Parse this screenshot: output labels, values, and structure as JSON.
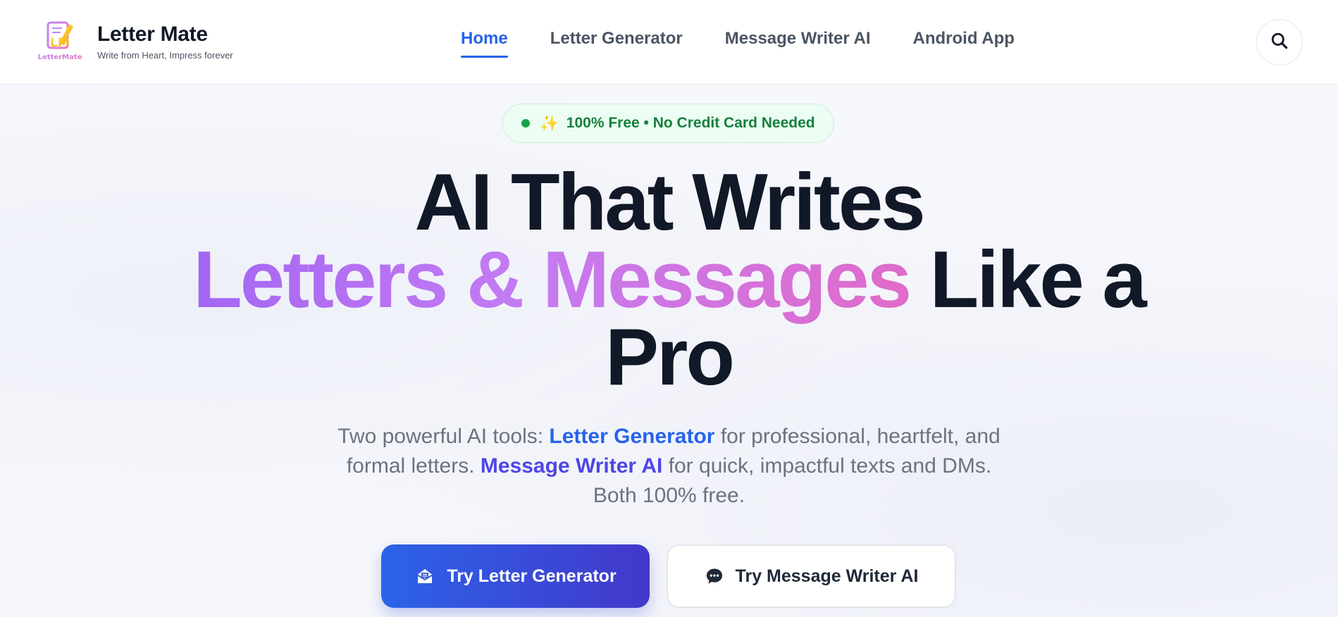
{
  "brand": {
    "name": "Letter Mate",
    "tagline": "Write from Heart, Impress forever",
    "logo_text": "LetterMate"
  },
  "nav": {
    "items": [
      {
        "label": "Home",
        "active": true
      },
      {
        "label": "Letter Generator",
        "active": false
      },
      {
        "label": "Message Writer AI",
        "active": false
      },
      {
        "label": "Android App",
        "active": false
      }
    ]
  },
  "search": {
    "icon": "search-icon"
  },
  "hero": {
    "badge": "100% Free • No Credit Card Needed",
    "badge_icon": "sparkle-icon",
    "headline_line1": "AI That Writes",
    "headline_gradient": "Letters & Messages",
    "headline_rest": " Like a",
    "headline_line3": "Pro",
    "sub_part1": "Two powerful AI tools: ",
    "sub_hl1": "Letter Generator",
    "sub_part2": " for professional, heartfelt, and",
    "sub_part3": "formal letters. ",
    "sub_hl2": "Message Writer AI",
    "sub_part4": " for quick, impactful texts and DMs.",
    "sub_part5": "Both 100% free.",
    "primary_button": "Try Letter Generator",
    "secondary_button": "Try Message Writer AI"
  },
  "colors": {
    "accent": "#2563eb",
    "badge_green": "#15803d",
    "gradient_start": "#a466f2",
    "gradient_end": "#e06bc9",
    "button_gradient_start": "#2c63e8",
    "button_gradient_end": "#4338ca"
  }
}
